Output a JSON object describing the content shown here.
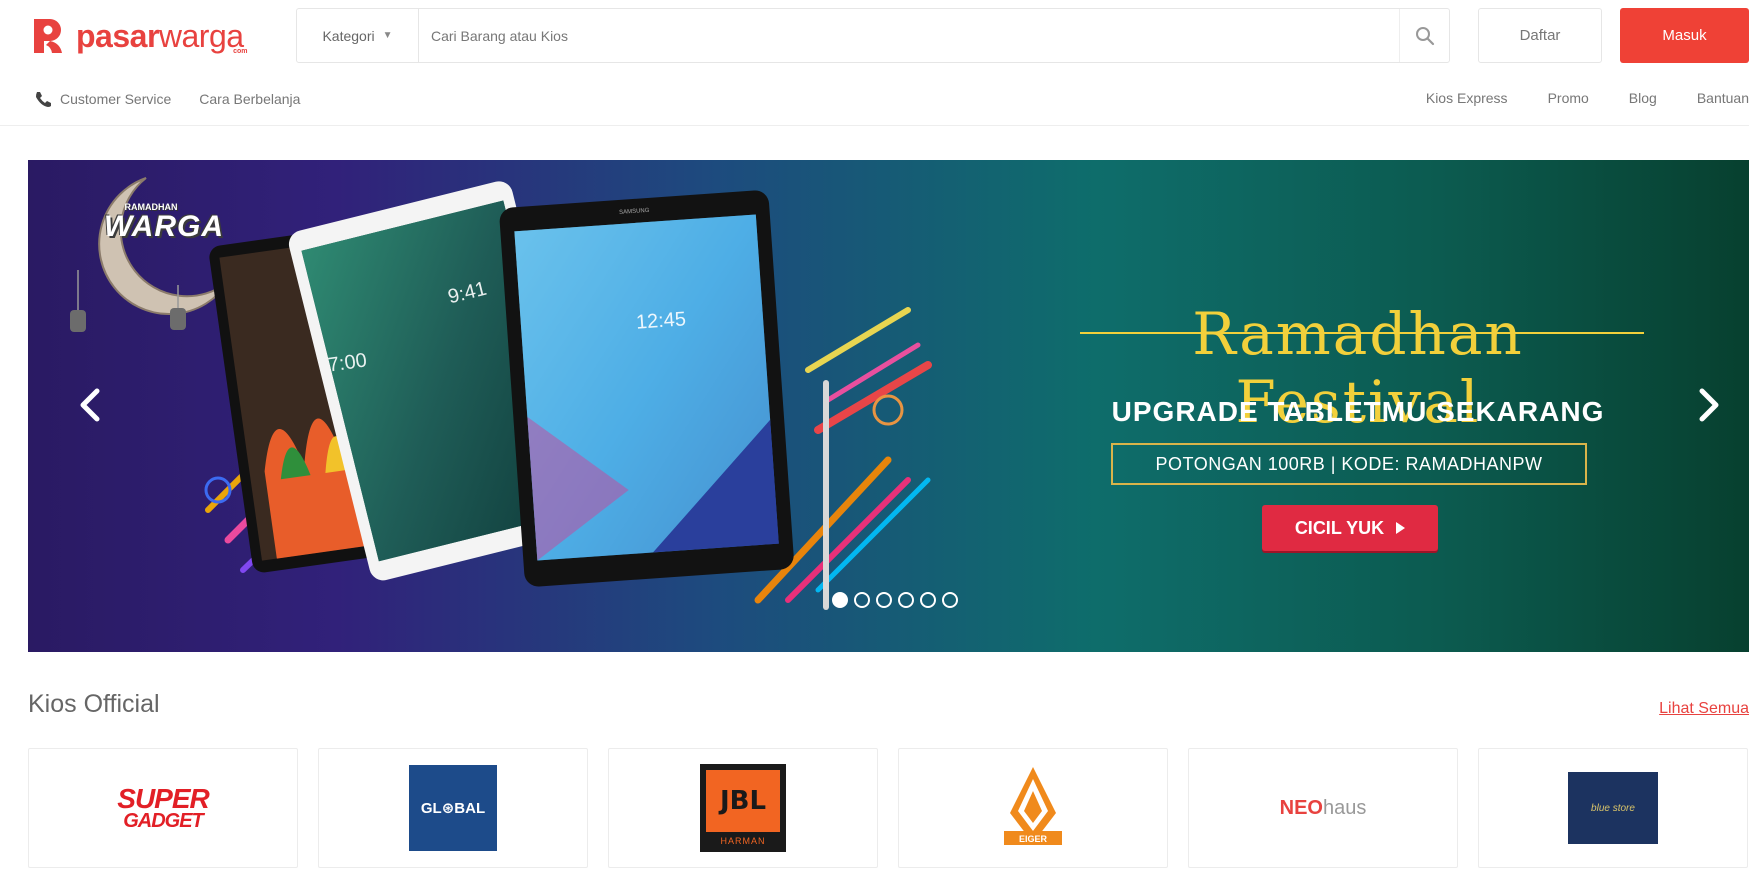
{
  "brand": {
    "name_bold": "pasar",
    "name_light": "warga",
    "name_suffix": "com"
  },
  "search": {
    "category_label": "Kategori",
    "placeholder": "Cari Barang atau Kios"
  },
  "auth": {
    "register_label": "Daftar",
    "login_label": "Masuk"
  },
  "subnav": {
    "left": [
      "Customer Service",
      "Cara Berbelanja"
    ],
    "right": [
      "Kios Express",
      "Promo",
      "Blog",
      "Bantuan"
    ]
  },
  "banner": {
    "badge_small": "RAMADHAN",
    "badge_big": "WARGA",
    "headline": "Ramadhan Festival",
    "subheadline": "UPGRADE TABLETMU SEKARANG",
    "promo": "POTONGAN 100RB  |  KODE: RAMADHANPW",
    "cta_label": "CICIL YUK",
    "tablet_times": [
      "9:41",
      "12:45",
      "7:00"
    ],
    "slide_count": 6,
    "active_slide": 0,
    "tablet_brand": "SAMSUNG"
  },
  "kios": {
    "title": "Kios Official",
    "see_all": "Lihat Semua",
    "stores": [
      {
        "name": "Super Gadget",
        "line1": "SUPER",
        "line2": "GADGET"
      },
      {
        "name": "Global",
        "text": "GL⊛BAL"
      },
      {
        "name": "JBL",
        "text": "JBL",
        "sub": "HARMAN"
      },
      {
        "name": "Eiger",
        "text": "EIGER"
      },
      {
        "name": "Neohaus",
        "bold": "NEO",
        "light": "haus"
      },
      {
        "name": "Blue Store",
        "text": "blue store"
      }
    ]
  },
  "colors": {
    "brand_red": "#ef4136",
    "headline_gold": "#f2d03b",
    "cta_red": "#e02a42"
  }
}
